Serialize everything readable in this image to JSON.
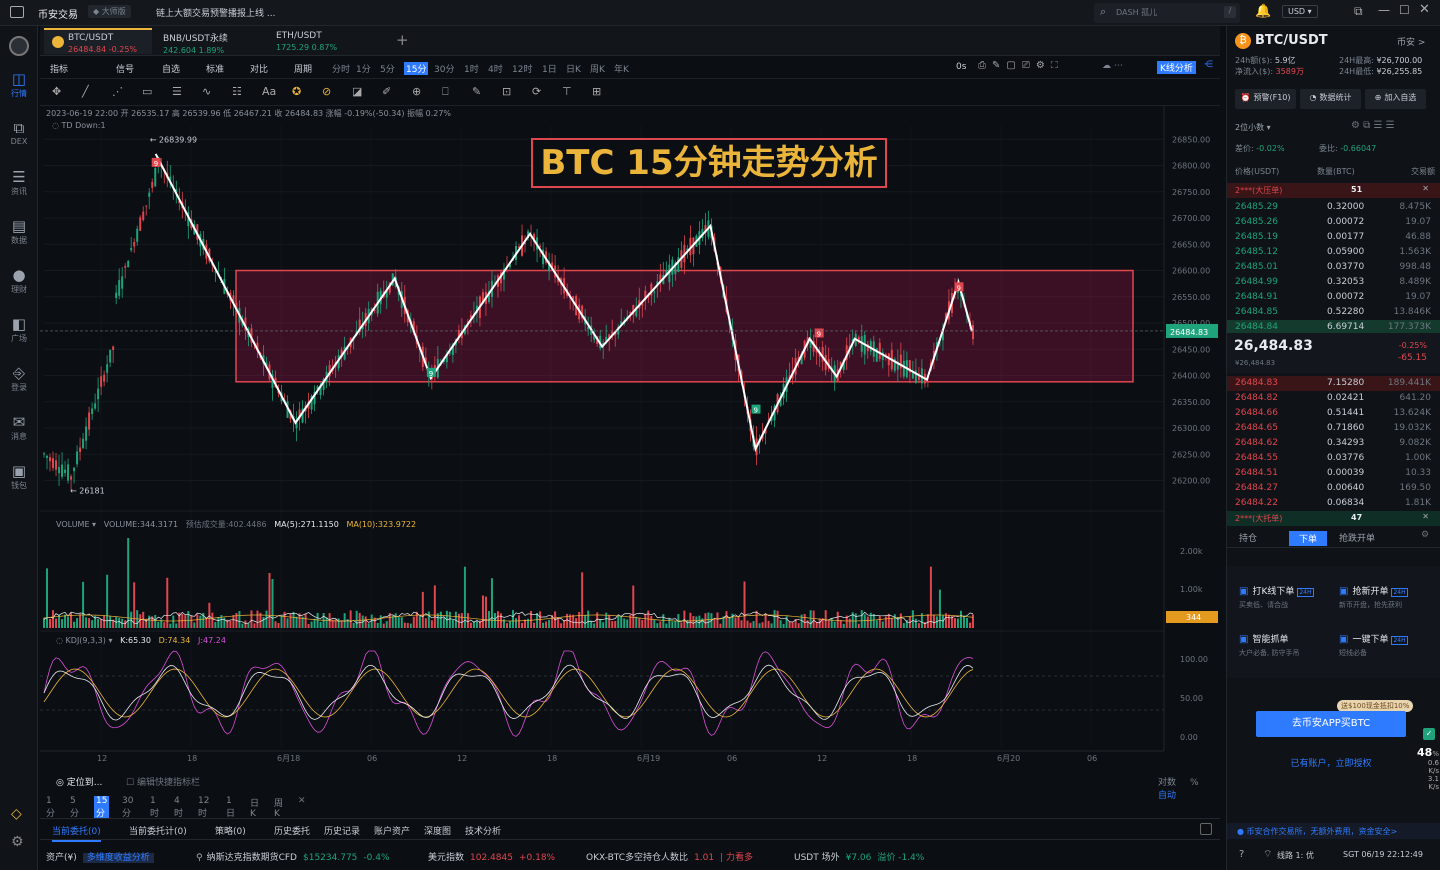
{
  "titlebar": {
    "app_name": "币安交易",
    "badge": "大师版",
    "notice": "链上大额交易预警播报上线 ...",
    "search_placeholder": "DASH 孤儿",
    "search_shortcut": "/",
    "currency": "USD"
  },
  "leftbar": [
    {
      "label": "行情",
      "icon": "chart-icon",
      "active": true
    },
    {
      "label": "DEX",
      "icon": "dex-icon"
    },
    {
      "label": "资讯",
      "icon": "news-icon"
    },
    {
      "label": "数据",
      "icon": "data-icon"
    },
    {
      "label": "理财",
      "icon": "finance-icon"
    },
    {
      "label": "广场",
      "icon": "square-icon"
    },
    {
      "label": "登录",
      "icon": "login-icon"
    },
    {
      "label": "消息",
      "icon": "message-icon"
    },
    {
      "label": "钱包",
      "icon": "wallet-icon"
    }
  ],
  "tabs": [
    {
      "name": "BTC/USDT",
      "price": "26484.84",
      "change": "-0.25%",
      "active": true
    },
    {
      "name": "BNB/USDT永续",
      "price": "242.604",
      "change": "1.89%"
    },
    {
      "name": "ETH/USDT",
      "price": "1725.29",
      "change": "0.87%"
    }
  ],
  "timeframes": [
    "分时",
    "1分",
    "5分",
    "15分",
    "30分",
    "1时",
    "4时",
    "12时",
    "1日",
    "日K",
    "周K",
    "年K"
  ],
  "active_timeframe": "15分",
  "toolbar_left": [
    "指标",
    "信号",
    "自选",
    "标准",
    "对比",
    "周期"
  ],
  "toolbar_right": [
    "0s",
    "K线分析"
  ],
  "ohlc_line": "2023-06-19 22:00  开 26535.17  高 26539.96  低 26467.21  收 26484.83  涨幅 -0.19%(-50.34)  振幅 0.27%",
  "td_line": "TD  Down:1",
  "annotation_title": "BTC 15分钟走势分析",
  "chart_data": {
    "type": "candlestick",
    "ylim": [
      26180,
      26860
    ],
    "y_ticks": [
      "26850.00",
      "26800.00",
      "26750.00",
      "26700.00",
      "26650.00",
      "26600.00",
      "26550.00",
      "26500.00",
      "26450.00",
      "26400.00",
      "26350.00",
      "26300.00",
      "26250.00",
      "26200.00"
    ],
    "y_tick_values": [
      26850,
      26800,
      26750,
      26700,
      26650,
      26600,
      26550,
      26500,
      26450,
      26400,
      26350,
      26300,
      26250,
      26200
    ],
    "x_labels": [
      "12",
      "18",
      "6月18",
      "06",
      "12",
      "18",
      "6月19",
      "06",
      "12",
      "18",
      "6月20",
      "06"
    ],
    "high_label": "26839.99",
    "low_label": "26181",
    "last_price": "26484.83",
    "range_box": [
      26388,
      26600
    ],
    "zigzag": [
      {
        "t": 0.095,
        "p": 26822
      },
      {
        "t": 0.25,
        "p": 26310
      },
      {
        "t": 0.36,
        "p": 26585
      },
      {
        "t": 0.4,
        "p": 26395
      },
      {
        "t": 0.51,
        "p": 26670
      },
      {
        "t": 0.59,
        "p": 26455
      },
      {
        "t": 0.71,
        "p": 26685
      },
      {
        "t": 0.76,
        "p": 26260
      },
      {
        "t": 0.82,
        "p": 26470
      },
      {
        "t": 0.85,
        "p": 26398
      },
      {
        "t": 0.87,
        "p": 26470
      },
      {
        "t": 0.95,
        "p": 26392
      },
      {
        "t": 0.985,
        "p": 26578
      },
      {
        "t": 1.0,
        "p": 26484
      }
    ],
    "volume_label": "VOLUME",
    "volume_value": "VOLUME:344.3171",
    "volume_est": "预估成交量:402.4486",
    "ma5": "MA(5):271.1150",
    "ma10": "MA(10):323.9722",
    "volume_ticks": [
      "2.00k",
      "1.00k"
    ],
    "volume_last": "344",
    "kdj_label": "KDJ(9,3,3)",
    "kdj_k": "K:65.30",
    "kdj_d": "D:74.34",
    "kdj_j": "J:47.24",
    "kdj_ticks": [
      "100.00",
      "50.00",
      "0.00"
    ]
  },
  "bottom": {
    "locate": "定位到...",
    "hint": "编辑快捷指标栏",
    "periods": [
      "分时",
      "1分",
      "5分",
      "15分",
      "30分",
      "1时",
      "4时",
      "12时",
      "1日",
      "日K",
      "周K",
      "年K"
    ],
    "right_links": [
      "对数",
      "%",
      "自动"
    ],
    "tabs": [
      "当前委托(0)",
      "当前委托计(0)",
      "策略(0)",
      "历史委托",
      "历史记录",
      "账户资产",
      "深度图",
      "技术分析"
    ],
    "ticker": [
      {
        "label": "资产(¥)",
        "value": "多维度收益分析"
      },
      {
        "label": "纳斯达克指数期货CFD",
        "value": "$15234.775",
        "change": "-0.4%"
      },
      {
        "label": "美元指数",
        "value": "102.4845",
        "change": "+0.18%"
      },
      {
        "label": "OKX-BTC多空持仓人数比",
        "value": "1.01",
        "change": "| 力看多"
      },
      {
        "label": "USDT 场外",
        "value": "¥7.06",
        "change": "溢价 -1.4%"
      }
    ]
  },
  "right": {
    "pair": "BTC/USDT",
    "pair_link": "币安 >",
    "vol_24h_label": "24h额($):",
    "vol_24h": "5.9亿",
    "high_24h_label": "24H最高:",
    "high_24h": "¥26,700.00",
    "inflow_label": "净流入($):",
    "inflow": "3589万",
    "low_24h_label": "24H最低:",
    "low_24h": "¥26,255.85",
    "buttons": [
      "预警(F10)",
      "数据统计",
      "加入自选"
    ],
    "decimals": "2位小数",
    "spread_label": "差价:",
    "spread": "-0.02%",
    "ratio_label": "委比:",
    "ratio": "-0.66047",
    "col_price": "价格(USDT)",
    "col_qty": "数量(BTC)",
    "col_total": "交易额",
    "ask_wall": "2***(大压单)",
    "ask_wall_count": "51",
    "asks": [
      [
        "26485.29",
        "0.32000",
        "8.475K"
      ],
      [
        "26485.26",
        "0.00072",
        "19.07"
      ],
      [
        "26485.19",
        "0.00177",
        "46.88"
      ],
      [
        "26485.12",
        "0.05900",
        "1.563K"
      ],
      [
        "26485.01",
        "0.03770",
        "998.48"
      ],
      [
        "26484.99",
        "0.32053",
        "8.489K"
      ],
      [
        "26484.91",
        "0.00072",
        "19.07"
      ],
      [
        "26484.85",
        "0.52280",
        "13.846K"
      ],
      [
        "26484.84",
        "6.69714",
        "177.373K"
      ]
    ],
    "last": "26,484.83",
    "last_cny": "¥26,484.83",
    "last_change_pct": "-0.25%",
    "last_change": "-65.15",
    "bids": [
      [
        "26484.83",
        "7.15280",
        "189.441K"
      ],
      [
        "26484.82",
        "0.02421",
        "641.20"
      ],
      [
        "26484.66",
        "0.51441",
        "13.624K"
      ],
      [
        "26484.65",
        "0.71860",
        "19.032K"
      ],
      [
        "26484.62",
        "0.34293",
        "9.082K"
      ],
      [
        "26484.55",
        "0.03776",
        "1.00K"
      ],
      [
        "26484.51",
        "0.00039",
        "10.33"
      ],
      [
        "26484.27",
        "0.00640",
        "169.50"
      ],
      [
        "26484.22",
        "0.06834",
        "1.81K"
      ]
    ],
    "bid_wall": "2***(大托单)",
    "bid_wall_count": "47",
    "order_tabs": [
      "持仓",
      "下单",
      "抢跌开单"
    ],
    "features": [
      {
        "title": "打K线下单",
        "desc": "买卖低、请合战",
        "tag": "24H"
      },
      {
        "title": "抢新开单",
        "desc": "新币开盘，抢先获利",
        "tag": "24H"
      },
      {
        "title": "智能抓单",
        "desc": "大户必备, 防守手吊",
        "tag": ""
      },
      {
        "title": "一键下单",
        "desc": "短线必备",
        "tag": "24H"
      }
    ],
    "promo_badge": "送$100现金抵扣10%",
    "cta": "去币安APP买BTC",
    "cta2": "已有账户，立即授权",
    "score": "48",
    "score_unit": "%",
    "speed_up": "0.6",
    "speed_down": "3.1",
    "speed_unit": "K/s",
    "security": "币安合作交易所，无额外费用，资金安全>",
    "line": "线路 1: 优",
    "clock": "SGT 06/19 22:12:49"
  },
  "colors": {
    "up": "#1fa37a",
    "down": "#e0464e",
    "accent": "#eab53a",
    "blue": "#2f7bff"
  }
}
